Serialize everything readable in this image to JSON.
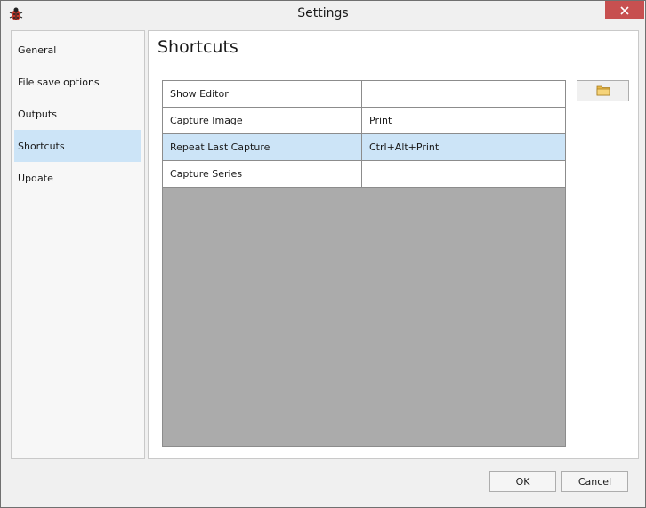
{
  "window": {
    "title": "Settings"
  },
  "sidebar": {
    "items": [
      {
        "label": "General"
      },
      {
        "label": "File save options"
      },
      {
        "label": "Outputs"
      },
      {
        "label": "Shortcuts",
        "selected": true
      },
      {
        "label": "Update"
      }
    ]
  },
  "main": {
    "title": "Shortcuts",
    "shortcuts": [
      {
        "name": "Show Editor",
        "key": ""
      },
      {
        "name": "Capture Image",
        "key": "Print"
      },
      {
        "name": "Repeat Last Capture",
        "key": "Ctrl+Alt+Print",
        "selected": true
      },
      {
        "name": "Capture Series",
        "key": ""
      }
    ],
    "browse_icon": "folder-icon"
  },
  "footer": {
    "ok_label": "OK",
    "cancel_label": "Cancel"
  },
  "colors": {
    "selection": "#cce4f7",
    "grid_background": "#ababab",
    "close_button": "#c75050"
  }
}
